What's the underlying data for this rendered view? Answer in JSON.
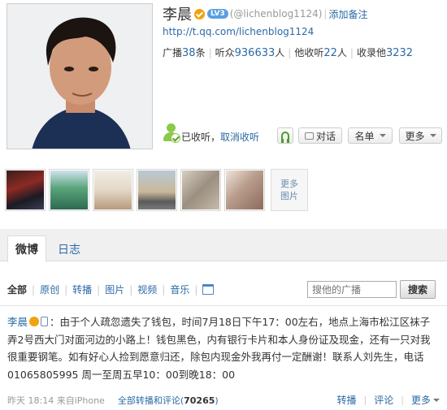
{
  "profile": {
    "name": "李晨",
    "level_badge": "LV3",
    "handle": "(@lichenblog1124)",
    "separator": "|",
    "add_remark": "添加备注",
    "url": "http://t.qq.com/lichenblog1124"
  },
  "stats": {
    "broadcast_label": "广播",
    "broadcast_count": "38",
    "broadcast_unit": "条",
    "listeners_label": "听众",
    "listeners_count": "936633",
    "listeners_unit": "人",
    "following_label": "他收听",
    "following_count": "22",
    "following_unit": "人",
    "collected_label": "收录他",
    "collected_count": "3232"
  },
  "actions": {
    "followed": "已收听，",
    "unfollow": "取消收听",
    "dialog": "对话",
    "list": "名单",
    "more": "更多"
  },
  "photos": {
    "more_label_1": "更多",
    "more_label_2": "图片"
  },
  "tabs": {
    "weibo": "微博",
    "diary": "日志"
  },
  "filters": {
    "items": [
      "全部",
      "原创",
      "转播",
      "图片",
      "视频",
      "音乐"
    ],
    "search_placeholder": "搜他的广播",
    "search_button": "搜索"
  },
  "post": {
    "author": "李晨",
    "text": "：由于个人疏忽遗失了钱包，时间7月18日下午17：00左右，地点上海市松江区袜子弄2号西大门对面河边的小路上！钱包黑色，内有银行卡片和本人身份证及现金，还有一只对我很重要钢笔。如有好心人捡到愿意归还，除包内现金外我再付一定酬谢！联系人刘先生，电话01065805995 周一至周五早10：00到晚18：00",
    "time_source": "昨天 18:14 来自iPhone",
    "thread_label": "全部转播和评论(",
    "thread_count": "70265",
    "thread_close": ")",
    "repost": "转播",
    "comment": "评论",
    "more": "更多"
  },
  "colors": {
    "link": "#2b6aa5",
    "badge": "#f0a30a",
    "tab_bar": "#f0f0f0"
  }
}
